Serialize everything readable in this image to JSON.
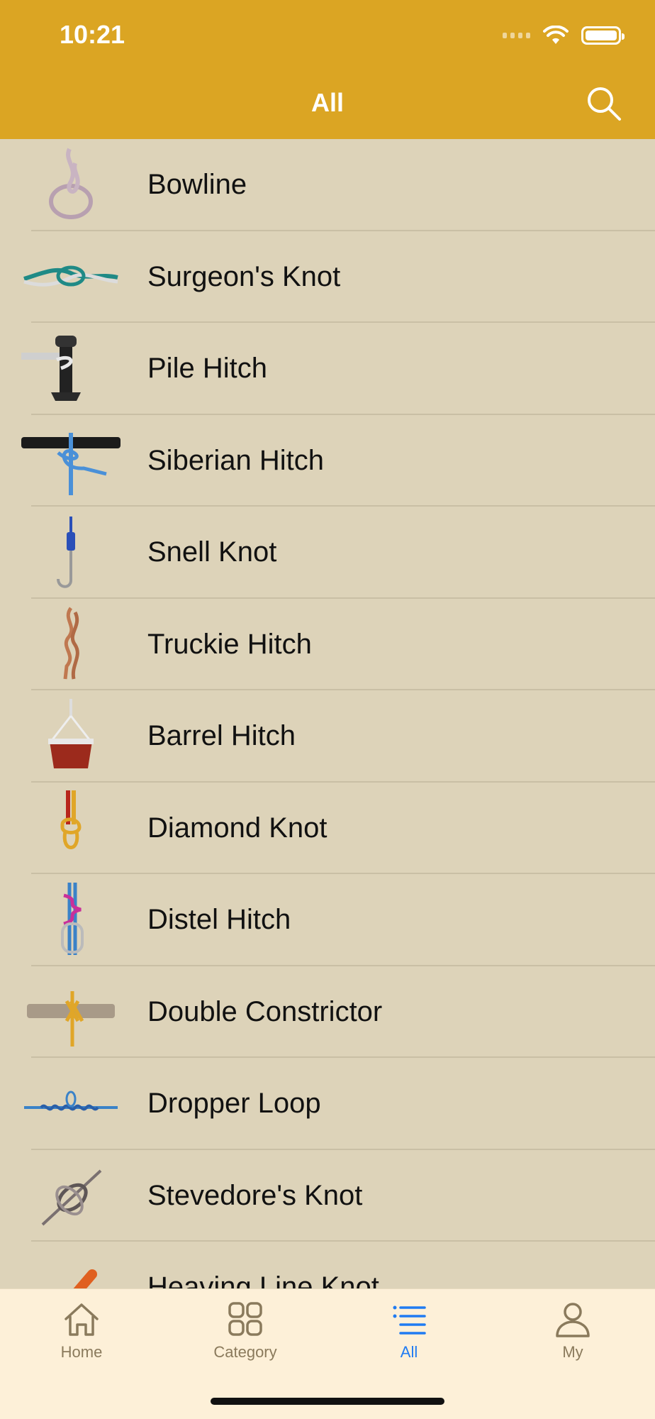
{
  "status": {
    "time": "10:21"
  },
  "header": {
    "title": "All"
  },
  "knots": [
    {
      "name": "Bowline",
      "icon": "bowline-icon"
    },
    {
      "name": "Surgeon's Knot",
      "icon": "surgeons-knot-icon"
    },
    {
      "name": "Pile Hitch",
      "icon": "pile-hitch-icon"
    },
    {
      "name": "Siberian Hitch",
      "icon": "siberian-hitch-icon"
    },
    {
      "name": "Snell Knot",
      "icon": "snell-knot-icon"
    },
    {
      "name": "Truckie Hitch",
      "icon": "truckie-hitch-icon"
    },
    {
      "name": "Barrel Hitch",
      "icon": "barrel-hitch-icon"
    },
    {
      "name": "Diamond Knot",
      "icon": "diamond-knot-icon"
    },
    {
      "name": "Distel Hitch",
      "icon": "distel-hitch-icon"
    },
    {
      "name": "Double Constrictor",
      "icon": "double-constrictor-icon"
    },
    {
      "name": "Dropper Loop",
      "icon": "dropper-loop-icon"
    },
    {
      "name": "Stevedore's Knot",
      "icon": "stevedores-knot-icon"
    },
    {
      "name": "Heaving Line Knot",
      "icon": "heaving-line-knot-icon"
    }
  ],
  "tabs": [
    {
      "label": "Home",
      "icon": "home-icon"
    },
    {
      "label": "Category",
      "icon": "category-grid-icon"
    },
    {
      "label": "All",
      "icon": "list-icon",
      "active": true
    },
    {
      "label": "My",
      "icon": "person-icon"
    }
  ],
  "colors": {
    "header": "#dba523",
    "background": "#ddd3b9",
    "tabbar": "#fdf0d8",
    "active": "#1f7bf2",
    "inactive": "#8a7a5c"
  }
}
